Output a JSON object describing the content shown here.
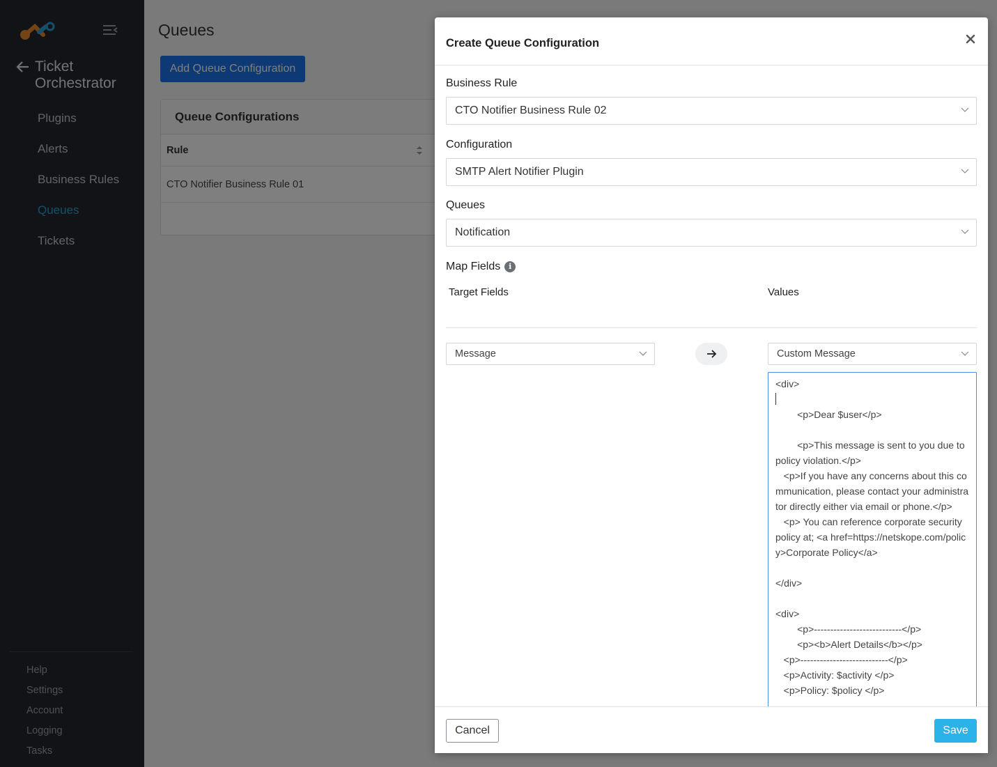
{
  "app": {
    "title_line1": "Ticket",
    "title_line2": "Orchestrator",
    "accent_color": "#2a9fd6",
    "logo_icon": "netskope-logo"
  },
  "sidebar": {
    "nav_items": [
      {
        "label": "Plugins",
        "active": false
      },
      {
        "label": "Alerts",
        "active": false
      },
      {
        "label": "Business Rules",
        "active": false
      },
      {
        "label": "Queues",
        "active": true
      },
      {
        "label": "Tickets",
        "active": false
      }
    ],
    "footer_items": [
      {
        "label": "Help"
      },
      {
        "label": "Settings"
      },
      {
        "label": "Account"
      },
      {
        "label": "Logging"
      },
      {
        "label": "Tasks"
      }
    ]
  },
  "page": {
    "title": "Queues",
    "add_button": "Add Queue Configuration",
    "card_title": "Queue Configurations",
    "table": {
      "columns": [
        "Rule"
      ],
      "rows": [
        "CTO Notifier Business Rule 01"
      ]
    }
  },
  "modal": {
    "title": "Create Queue Configuration",
    "business_rule": {
      "label": "Business Rule",
      "value": "CTO Notifier Business Rule 02"
    },
    "configuration": {
      "label": "Configuration",
      "value": "SMTP Alert Notifier Plugin"
    },
    "queues": {
      "label": "Queues",
      "value": "Notification"
    },
    "map_fields": {
      "label": "Map Fields",
      "target_header": "Target Fields",
      "values_header": "Values",
      "target_value": "Message",
      "value_type": "Custom Message",
      "message_before_caret": "<div>\n",
      "message_after_caret": "\n        <p>Dear $user</p>\n\n        <p>This message is sent to you due to policy violation.</p>\n   <p>If you have any concerns about this communication, please contact your administrator directly either via email or phone.</p>\n   <p> You can reference corporate security policy at; <a href=https://netskope.com/policy>Corporate Policy</a>\n\n</div>\n\n<div>\n        <p>---------------------------</p>\n        <p><b>Alert Details</b></p>\n   <p>---------------------------</p>\n   <p>Activity: $activity </p>\n   <p>Policy: $policy </p>"
    },
    "cancel_label": "Cancel",
    "save_label": "Save",
    "save_color": "#2bb3e9"
  }
}
